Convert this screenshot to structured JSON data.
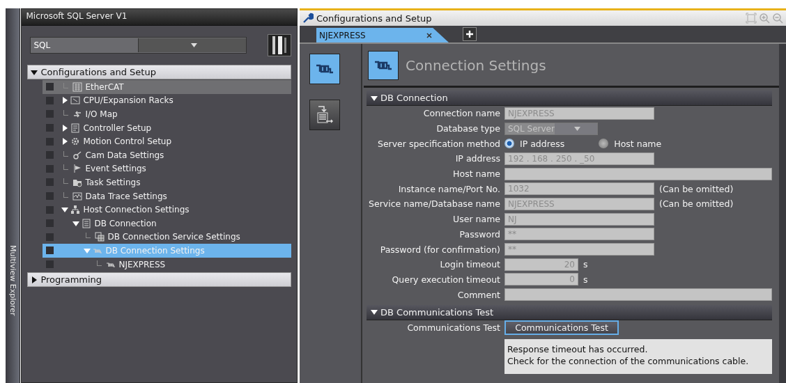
{
  "explorer": {
    "side_tab": "Multiview Explorer",
    "title": "Microsoft SQL Server V1",
    "device_select": {
      "value": "SQL"
    },
    "sections": [
      {
        "label": "Configurations and Setup",
        "expanded": true,
        "children": [
          {
            "label": "EtherCAT",
            "kind": "leaf",
            "hovered": true,
            "selected": false
          },
          {
            "label": "CPU/Expansion Racks",
            "kind": "folder",
            "expanded": false,
            "hovered": false,
            "selected": false
          },
          {
            "label": "I/O Map",
            "kind": "leaf",
            "hovered": false,
            "selected": false
          },
          {
            "label": "Controller Setup",
            "kind": "folder",
            "expanded": false,
            "hovered": false,
            "selected": false
          },
          {
            "label": "Motion Control Setup",
            "kind": "folder",
            "expanded": false,
            "hovered": false,
            "selected": false
          },
          {
            "label": "Cam Data Settings",
            "kind": "leaf",
            "hovered": false,
            "selected": false
          },
          {
            "label": "Event Settings",
            "kind": "leaf",
            "hovered": false,
            "selected": false
          },
          {
            "label": "Task Settings",
            "kind": "leaf",
            "hovered": false,
            "selected": false
          },
          {
            "label": "Data Trace Settings",
            "kind": "leaf",
            "hovered": false,
            "selected": false
          },
          {
            "label": "Host Connection Settings",
            "kind": "folder",
            "expanded": true,
            "hovered": false,
            "selected": false,
            "children": [
              {
                "label": "DB Connection",
                "kind": "folder",
                "expanded": true,
                "hovered": false,
                "selected": false,
                "children": [
                  {
                    "label": "DB Connection Service Settings",
                    "kind": "leaf",
                    "hovered": false,
                    "selected": false
                  },
                  {
                    "label": "DB Connection Settings",
                    "kind": "folder",
                    "expanded": true,
                    "hovered": false,
                    "selected": true,
                    "children": [
                      {
                        "label": "NJEXPRESS",
                        "kind": "leaf",
                        "hovered": false,
                        "selected": false
                      }
                    ]
                  }
                ]
              }
            ]
          }
        ]
      },
      {
        "label": "Programming",
        "expanded": false
      }
    ]
  },
  "editor": {
    "title": "Configurations and Setup",
    "tabs": [
      {
        "label": "NJEXPRESS",
        "selected": true
      }
    ],
    "side_buttons": [
      {
        "selected": true
      },
      {
        "selected": false
      }
    ],
    "page_title": "Connection Settings",
    "groups": [
      {
        "title": "DB Connection",
        "expanded": true,
        "fields": [
          {
            "kind": "text",
            "label": "Connection name",
            "value": "NJEXPRESS",
            "disabled": true
          },
          {
            "kind": "select",
            "label": "Database type",
            "value": "SQL Server",
            "disabled": true
          },
          {
            "kind": "radio",
            "label": "Server specification method",
            "options": [
              {
                "label": "IP address",
                "selected": true
              },
              {
                "label": "Host name",
                "selected": false
              }
            ]
          },
          {
            "kind": "text",
            "label": "IP address",
            "value": "192 . 168 . 250 . _50",
            "disabled": true
          },
          {
            "kind": "wide",
            "label": "Host name",
            "disabled": true
          },
          {
            "kind": "text",
            "label": "Instance name/Port No.",
            "value": "1032",
            "note": "(Can be omitted)",
            "disabled": true
          },
          {
            "kind": "text",
            "label": "Service name/Database name",
            "value": "NJEXPRESS",
            "note": "(Can be omitted)",
            "disabled": true
          },
          {
            "kind": "text",
            "label": "User name",
            "value": "NJ",
            "disabled": true
          },
          {
            "kind": "text",
            "label": "Password",
            "value": "**",
            "disabled": true
          },
          {
            "kind": "text",
            "label": "Password (for confirmation)",
            "value": "**",
            "disabled": true
          },
          {
            "kind": "number",
            "label": "Login timeout",
            "value": "20",
            "unit": "s",
            "disabled": true
          },
          {
            "kind": "number",
            "label": "Query execution timeout",
            "value": "0",
            "unit": "s",
            "disabled": true
          },
          {
            "kind": "wide",
            "label": "Comment",
            "disabled": true
          }
        ]
      },
      {
        "title": "DB Communications Test",
        "expanded": true,
        "fields": [
          {
            "kind": "button",
            "label": "Communications Test",
            "button": "Communications Test"
          },
          {
            "kind": "message",
            "lines": [
              "Response timeout has occurred.",
              "Check for the connection of the communications cable."
            ]
          }
        ]
      }
    ]
  }
}
